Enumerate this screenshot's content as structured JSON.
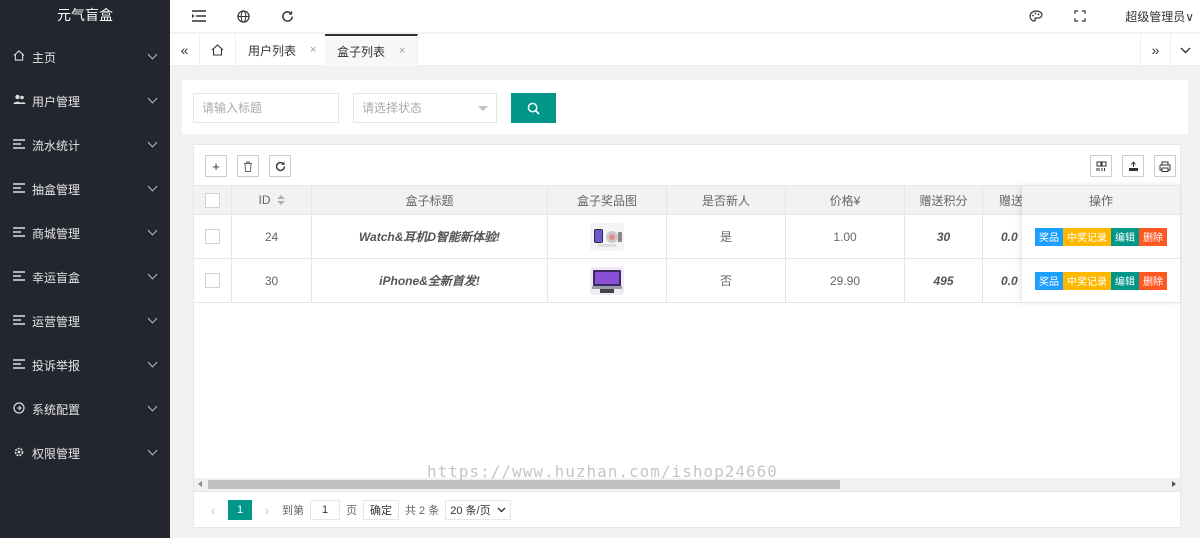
{
  "app": {
    "title": "元气盲盒"
  },
  "sidebar": {
    "items": [
      {
        "label": "主页",
        "icon": "home-icon"
      },
      {
        "label": "用户管理",
        "icon": "users-icon"
      },
      {
        "label": "流水统计",
        "icon": "list-icon"
      },
      {
        "label": "抽盒管理",
        "icon": "list-icon"
      },
      {
        "label": "商城管理",
        "icon": "list-icon"
      },
      {
        "label": "幸运盲盒",
        "icon": "list-icon"
      },
      {
        "label": "运营管理",
        "icon": "list-icon"
      },
      {
        "label": "投诉举报",
        "icon": "list-icon"
      },
      {
        "label": "系统配置",
        "icon": "settings-icon"
      },
      {
        "label": "权限管理",
        "icon": "gear-icon"
      }
    ]
  },
  "header": {
    "user": "超级管理员∨"
  },
  "tabs": [
    {
      "label": "用户列表",
      "close": "×"
    },
    {
      "label": "盒子列表",
      "close": "×",
      "active": true
    }
  ],
  "search": {
    "title_placeholder": "请输入标题",
    "status_placeholder": "请选择状态"
  },
  "table": {
    "columns": [
      "ID",
      "盒子标题",
      "盒子奖品图",
      "是否新人",
      "价格¥",
      "赠送积分",
      "赠送"
    ],
    "ops_header": "操作",
    "rows": [
      {
        "id": "24",
        "title": "Watch&耳机D智能新体验!",
        "is_new": "是",
        "price": "1.00",
        "points": "30",
        "gift": "0.0"
      },
      {
        "id": "30",
        "title": "iPhone&全新首发!",
        "is_new": "否",
        "price": "29.90",
        "points": "495",
        "gift": "0.0"
      }
    ],
    "ops": [
      {
        "label": "奖品",
        "color": "#1e9fff"
      },
      {
        "label": "中奖记录",
        "color": "#ffb800"
      },
      {
        "label": "编辑",
        "color": "#009688"
      },
      {
        "label": "删除",
        "color": "#ff5722"
      }
    ]
  },
  "pager": {
    "current": "1",
    "goto_label": "到第",
    "goto_value": "1",
    "page_unit": "页",
    "confirm": "确定",
    "total": "共 2 条",
    "per_page": "20 条/页"
  },
  "watermark": "https://www.huzhan.com/ishop24660",
  "colors": {
    "primary": "#009688",
    "sidebar": "#23262e"
  }
}
